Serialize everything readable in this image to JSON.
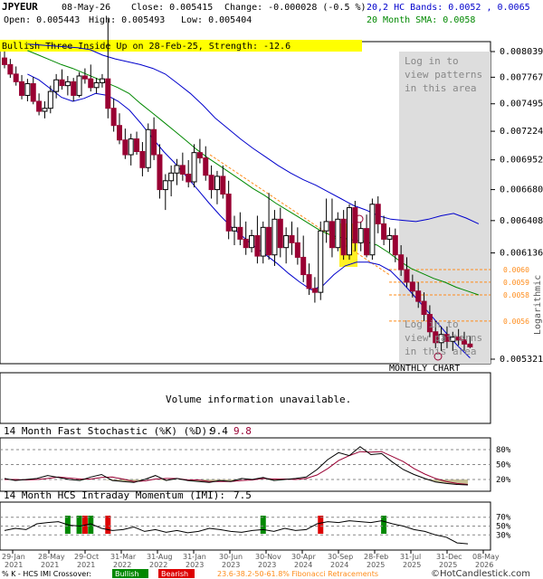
{
  "header": {
    "symbol": "JPYEUR",
    "date": "08-May-26",
    "close_label": "Close: 0.005415",
    "change_label": "Change: -0.000028 (-0.5 %)",
    "open_label": "Open: 0.005443",
    "high_label": "High: 0.005493",
    "low_label": "Low: 0.005404",
    "bands_label": "20,2 HC Bands: 0.0052 , 0.0065",
    "sma_label": "20 Month SMA: 0.0058"
  },
  "pattern_banner": "Bullish Three Inside Up on 28-Feb-25, Strength: -12.6",
  "login_notice": [
    "Log in to",
    "view patterns",
    "in this area"
  ],
  "chart_type_label": "MONTHLY CHART",
  "side_label": "Logarithmic",
  "volume_notice": "Volume information unavailable.",
  "stoch": {
    "title": "14 Month Fast Stochastic (%K) (%D):",
    "k_value": "9.4",
    "d_value": "9.8"
  },
  "imi": {
    "title": "14 Month HCS Intraday Momentum (IMI):",
    "value": "7.5"
  },
  "footer": {
    "crossover_label": "% K - HCS IMI Crossover:",
    "bullish_label": "Bullish",
    "bearish_label": "Bearish",
    "fib_label": "23.6-38.2-50-61.8% Fibonacci Retracements",
    "copyright": "©HotCandlestick.com"
  },
  "colors": {
    "bull_candle": "#ffffff",
    "bear_candle": "#990033",
    "band_line": "#0000cc",
    "sma_line": "#008800",
    "fib_line": "#ff8c1a",
    "banner_bg": "#ffff00",
    "highlight": "#ffee00",
    "login_area": "#dddddd",
    "stoch_fill": "#c8c296",
    "bullish_bg": "#008800",
    "bearish_bg": "#dd0000"
  },
  "chart_data": {
    "type": "candlestick",
    "scale": "logarithmic",
    "price_axis": {
      "ticks": [
        "0.008039",
        "0.007767",
        "0.007495",
        "0.007224",
        "0.006952",
        "0.006680",
        "0.006408",
        "0.006136",
        "0.005321"
      ],
      "tick_values": [
        0.008039,
        0.007767,
        0.007495,
        0.007224,
        0.006952,
        0.00668,
        0.006408,
        0.006136,
        0.005321
      ]
    },
    "fib_levels": {
      "labels": [
        "0.0060",
        "0.0059",
        "0.0058",
        "0.0056"
      ],
      "values": [
        0.006,
        0.0059,
        0.0058,
        0.0056
      ]
    },
    "x_ticks": [
      "29-Jan 2021",
      "28-May 2021",
      "29-Oct 2021",
      "31-Mar 2022",
      "31-Aug 2022",
      "31-Jan 2023",
      "30-Jun 2023",
      "30-Nov 2023",
      "30-Apr 2024",
      "30-Sep 2024",
      "28-Feb 2025",
      "31-Jul 2025",
      "31-Dec 2025",
      "08-May 2026"
    ],
    "candles": [
      {
        "o": 0.00797,
        "h": 0.00804,
        "l": 0.00786,
        "c": 0.0079
      },
      {
        "o": 0.0079,
        "h": 0.00796,
        "l": 0.00776,
        "c": 0.0078
      },
      {
        "o": 0.0078,
        "h": 0.00788,
        "l": 0.00768,
        "c": 0.00772
      },
      {
        "o": 0.00772,
        "h": 0.00779,
        "l": 0.00754,
        "c": 0.00758
      },
      {
        "o": 0.00758,
        "h": 0.00775,
        "l": 0.00752,
        "c": 0.0077
      },
      {
        "o": 0.0077,
        "h": 0.00777,
        "l": 0.00749,
        "c": 0.00752
      },
      {
        "o": 0.00752,
        "h": 0.0076,
        "l": 0.00738,
        "c": 0.00742
      },
      {
        "o": 0.00742,
        "h": 0.00752,
        "l": 0.00735,
        "c": 0.00745
      },
      {
        "o": 0.00745,
        "h": 0.00768,
        "l": 0.0074,
        "c": 0.00762
      },
      {
        "o": 0.00762,
        "h": 0.0078,
        "l": 0.00755,
        "c": 0.00774
      },
      {
        "o": 0.00774,
        "h": 0.00785,
        "l": 0.00764,
        "c": 0.00768
      },
      {
        "o": 0.00768,
        "h": 0.00778,
        "l": 0.00758,
        "c": 0.00772
      },
      {
        "o": 0.00772,
        "h": 0.00776,
        "l": 0.00752,
        "c": 0.00758
      },
      {
        "o": 0.00758,
        "h": 0.00782,
        "l": 0.00756,
        "c": 0.00778
      },
      {
        "o": 0.00778,
        "h": 0.00786,
        "l": 0.0077,
        "c": 0.00775
      },
      {
        "o": 0.00775,
        "h": 0.0079,
        "l": 0.00762,
        "c": 0.00766
      },
      {
        "o": 0.00766,
        "h": 0.00776,
        "l": 0.0076,
        "c": 0.00771
      },
      {
        "o": 0.00771,
        "h": 0.0078,
        "l": 0.00766,
        "c": 0.00775
      },
      {
        "o": 0.00775,
        "h": 0.0084,
        "l": 0.00735,
        "c": 0.00745
      },
      {
        "o": 0.00745,
        "h": 0.00755,
        "l": 0.00722,
        "c": 0.00728
      },
      {
        "o": 0.00728,
        "h": 0.0074,
        "l": 0.0071,
        "c": 0.00714
      },
      {
        "o": 0.00714,
        "h": 0.00725,
        "l": 0.00696,
        "c": 0.007
      },
      {
        "o": 0.007,
        "h": 0.0072,
        "l": 0.0069,
        "c": 0.00715
      },
      {
        "o": 0.00715,
        "h": 0.00722,
        "l": 0.007,
        "c": 0.00703
      },
      {
        "o": 0.00703,
        "h": 0.00712,
        "l": 0.0068,
        "c": 0.00688
      },
      {
        "o": 0.00688,
        "h": 0.0073,
        "l": 0.00684,
        "c": 0.00724
      },
      {
        "o": 0.00724,
        "h": 0.00736,
        "l": 0.00695,
        "c": 0.007
      },
      {
        "o": 0.007,
        "h": 0.0071,
        "l": 0.0066,
        "c": 0.00668
      },
      {
        "o": 0.00668,
        "h": 0.00682,
        "l": 0.0065,
        "c": 0.00676
      },
      {
        "o": 0.00676,
        "h": 0.0069,
        "l": 0.00662,
        "c": 0.00683
      },
      {
        "o": 0.00683,
        "h": 0.00696,
        "l": 0.00672,
        "c": 0.0069
      },
      {
        "o": 0.0069,
        "h": 0.00702,
        "l": 0.00676,
        "c": 0.00682
      },
      {
        "o": 0.00682,
        "h": 0.00695,
        "l": 0.0067,
        "c": 0.00675
      },
      {
        "o": 0.00675,
        "h": 0.0071,
        "l": 0.0067,
        "c": 0.00702
      },
      {
        "o": 0.00702,
        "h": 0.00715,
        "l": 0.00692,
        "c": 0.00697
      },
      {
        "o": 0.00697,
        "h": 0.00708,
        "l": 0.00676,
        "c": 0.00681
      },
      {
        "o": 0.00681,
        "h": 0.0069,
        "l": 0.0066,
        "c": 0.00668
      },
      {
        "o": 0.00668,
        "h": 0.00685,
        "l": 0.00655,
        "c": 0.0068
      },
      {
        "o": 0.0068,
        "h": 0.0069,
        "l": 0.0066,
        "c": 0.00664
      },
      {
        "o": 0.00664,
        "h": 0.00676,
        "l": 0.00625,
        "c": 0.00632
      },
      {
        "o": 0.00632,
        "h": 0.00645,
        "l": 0.0062,
        "c": 0.00635
      },
      {
        "o": 0.00635,
        "h": 0.00648,
        "l": 0.0062,
        "c": 0.00625
      },
      {
        "o": 0.00625,
        "h": 0.0064,
        "l": 0.00612,
        "c": 0.00618
      },
      {
        "o": 0.00618,
        "h": 0.00633,
        "l": 0.00614,
        "c": 0.00628
      },
      {
        "o": 0.00628,
        "h": 0.00645,
        "l": 0.00605,
        "c": 0.00611
      },
      {
        "o": 0.00611,
        "h": 0.0064,
        "l": 0.00605,
        "c": 0.00635
      },
      {
        "o": 0.00635,
        "h": 0.00665,
        "l": 0.00608,
        "c": 0.00612
      },
      {
        "o": 0.00612,
        "h": 0.0065,
        "l": 0.00603,
        "c": 0.00642
      },
      {
        "o": 0.00642,
        "h": 0.00652,
        "l": 0.0061,
        "c": 0.00618
      },
      {
        "o": 0.00618,
        "h": 0.00635,
        "l": 0.00605,
        "c": 0.00628
      },
      {
        "o": 0.00628,
        "h": 0.0064,
        "l": 0.00612,
        "c": 0.00622
      },
      {
        "o": 0.00622,
        "h": 0.00635,
        "l": 0.00604,
        "c": 0.0061
      },
      {
        "o": 0.0061,
        "h": 0.00628,
        "l": 0.0059,
        "c": 0.00596
      },
      {
        "o": 0.00596,
        "h": 0.00605,
        "l": 0.0058,
        "c": 0.00585
      },
      {
        "o": 0.00585,
        "h": 0.00594,
        "l": 0.00574,
        "c": 0.00582
      },
      {
        "o": 0.00582,
        "h": 0.0064,
        "l": 0.00576,
        "c": 0.00632
      },
      {
        "o": 0.00632,
        "h": 0.0066,
        "l": 0.00622,
        "c": 0.0064
      },
      {
        "o": 0.0064,
        "h": 0.0066,
        "l": 0.0061,
        "c": 0.00618
      },
      {
        "o": 0.00618,
        "h": 0.00648,
        "l": 0.00615,
        "c": 0.00642
      },
      {
        "o": 0.00642,
        "h": 0.0065,
        "l": 0.00608,
        "c": 0.00612
      },
      {
        "o": 0.00612,
        "h": 0.00655,
        "l": 0.00608,
        "c": 0.00652
      },
      {
        "o": 0.00652,
        "h": 0.00658,
        "l": 0.00615,
        "c": 0.00622
      },
      {
        "o": 0.00622,
        "h": 0.0064,
        "l": 0.00615,
        "c": 0.00634
      },
      {
        "o": 0.00634,
        "h": 0.00646,
        "l": 0.0061,
        "c": 0.00612
      },
      {
        "o": 0.00612,
        "h": 0.0066,
        "l": 0.00608,
        "c": 0.00655
      },
      {
        "o": 0.00655,
        "h": 0.00662,
        "l": 0.0063,
        "c": 0.00638
      },
      {
        "o": 0.00638,
        "h": 0.00645,
        "l": 0.0062,
        "c": 0.00625
      },
      {
        "o": 0.00625,
        "h": 0.00635,
        "l": 0.00614,
        "c": 0.00628
      },
      {
        "o": 0.00628,
        "h": 0.00634,
        "l": 0.00606,
        "c": 0.00612
      },
      {
        "o": 0.00612,
        "h": 0.0062,
        "l": 0.00595,
        "c": 0.006
      },
      {
        "o": 0.006,
        "h": 0.0061,
        "l": 0.00586,
        "c": 0.0059
      },
      {
        "o": 0.0059,
        "h": 0.00596,
        "l": 0.00578,
        "c": 0.00583
      },
      {
        "o": 0.00583,
        "h": 0.0059,
        "l": 0.0057,
        "c": 0.00575
      },
      {
        "o": 0.00575,
        "h": 0.00582,
        "l": 0.0056,
        "c": 0.00565
      },
      {
        "o": 0.00565,
        "h": 0.00572,
        "l": 0.00548,
        "c": 0.00552
      },
      {
        "o": 0.00552,
        "h": 0.0056,
        "l": 0.0054,
        "c": 0.00544
      },
      {
        "o": 0.00544,
        "h": 0.00556,
        "l": 0.00538,
        "c": 0.0055
      },
      {
        "o": 0.0055,
        "h": 0.00556,
        "l": 0.0054,
        "c": 0.00545
      },
      {
        "o": 0.00545,
        "h": 0.00552,
        "l": 0.00538,
        "c": 0.00548
      },
      {
        "o": 0.00548,
        "h": 0.00554,
        "l": 0.00542,
        "c": 0.00546
      },
      {
        "o": 0.00546,
        "h": 0.00552,
        "l": 0.00538,
        "c": 0.00543
      },
      {
        "o": 0.00543,
        "h": 0.00549,
        "l": 0.0054,
        "c": 0.00541
      }
    ],
    "upper_band": [
      0.00812,
      0.00811,
      0.0081,
      0.00809,
      0.00808,
      0.00806,
      0.008,
      0.00796,
      0.00793,
      0.0079,
      0.00786,
      0.0078,
      0.0077,
      0.0076,
      0.00748,
      0.00735,
      0.00725,
      0.00715,
      0.00706,
      0.00698,
      0.0069,
      0.00683,
      0.00677,
      0.00672,
      0.00666,
      0.0066,
      0.00654,
      0.0065,
      0.00645,
      0.00642,
      0.00641,
      0.0064,
      0.00642,
      0.00645,
      0.00647,
      0.00643,
      0.00638
    ],
    "sma": [
      0.00805,
      0.008,
      0.00795,
      0.0079,
      0.00786,
      0.00781,
      0.00776,
      0.00771,
      0.00766,
      0.0076,
      0.0075,
      0.00741,
      0.00732,
      0.00723,
      0.00714,
      0.00705,
      0.00697,
      0.0069,
      0.00683,
      0.00676,
      0.00669,
      0.00663,
      0.00656,
      0.0065,
      0.00644,
      0.00638,
      0.00632,
      0.00628,
      0.00626,
      0.00624,
      0.00623,
      0.0062,
      0.00614,
      0.00607,
      0.00601,
      0.00597,
      0.00593,
      0.0059,
      0.00586,
      0.00583,
      0.0058
    ],
    "lower_band": [
      0.0078,
      0.00774,
      0.00765,
      0.00756,
      0.00752,
      0.00755,
      0.0076,
      0.00758,
      0.00752,
      0.00743,
      0.0073,
      0.00716,
      0.00703,
      0.00692,
      0.0068,
      0.00668,
      0.00656,
      0.00645,
      0.00635,
      0.00627,
      0.00619,
      0.00612,
      0.00605,
      0.00597,
      0.0059,
      0.00584,
      0.00587,
      0.00596,
      0.00603,
      0.00606,
      0.00606,
      0.00604,
      0.00599,
      0.0059,
      0.0058,
      0.0057,
      0.0056,
      0.0055,
      0.00541,
      0.00533
    ],
    "stoch_ticks": [
      "80%",
      "50%",
      "20%"
    ],
    "stoch_k": [
      22,
      18,
      20,
      22,
      28,
      24,
      20,
      18,
      25,
      30,
      18,
      16,
      14,
      20,
      28,
      18,
      22,
      18,
      16,
      14,
      18,
      16,
      22,
      20,
      24,
      18,
      20,
      22,
      25,
      40,
      60,
      74,
      68,
      86,
      70,
      72,
      55,
      40,
      30,
      22,
      15,
      12,
      10,
      9
    ],
    "stoch_d": [
      20,
      20,
      19,
      20,
      22,
      25,
      23,
      21,
      21,
      24,
      25,
      21,
      16,
      17,
      21,
      22,
      22,
      19,
      19,
      16,
      16,
      16,
      18,
      19,
      22,
      21,
      21,
      20,
      22,
      29,
      42,
      58,
      68,
      76,
      75,
      76,
      66,
      56,
      42,
      31,
      22,
      16,
      12,
      10
    ],
    "imi_ticks": [
      "70%",
      "50%",
      "30%"
    ],
    "imi": [
      40,
      45,
      42,
      55,
      58,
      60,
      52,
      50,
      55,
      45,
      40,
      42,
      48,
      38,
      42,
      36,
      40,
      35,
      38,
      45,
      42,
      38,
      36,
      40,
      42,
      38,
      45,
      40,
      42,
      55,
      60,
      58,
      62,
      60,
      58,
      62,
      55,
      50,
      42,
      38,
      30,
      25,
      12,
      10
    ],
    "bullish_markers": [
      11,
      13,
      15,
      45,
      66
    ],
    "bearish_markers": [
      14,
      18,
      55
    ]
  }
}
